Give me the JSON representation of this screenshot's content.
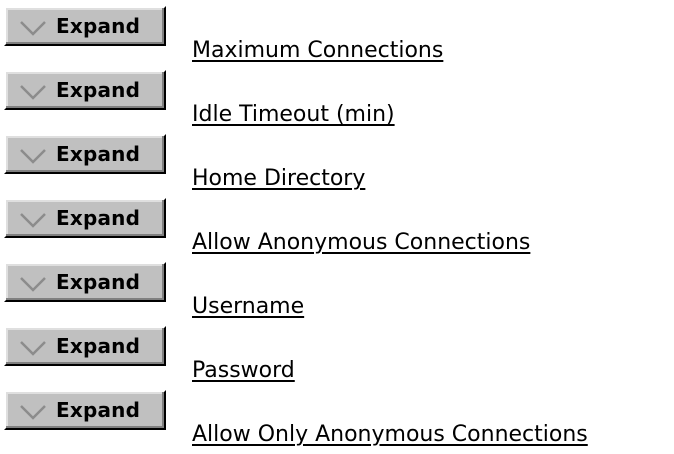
{
  "expand_label": "Expand",
  "icon": "chevron-down-icon",
  "items": [
    {
      "label": "Maximum Connections"
    },
    {
      "label": "Idle Timeout (min)"
    },
    {
      "label": "Home Directory"
    },
    {
      "label": "Allow Anonymous Connections"
    },
    {
      "label": "Username"
    },
    {
      "label": "Password"
    },
    {
      "label": "Allow Only Anonymous Connections"
    }
  ],
  "colors": {
    "button_face": "#c0c0c0",
    "chevron": "#8c8c8c",
    "text": "#000000"
  }
}
